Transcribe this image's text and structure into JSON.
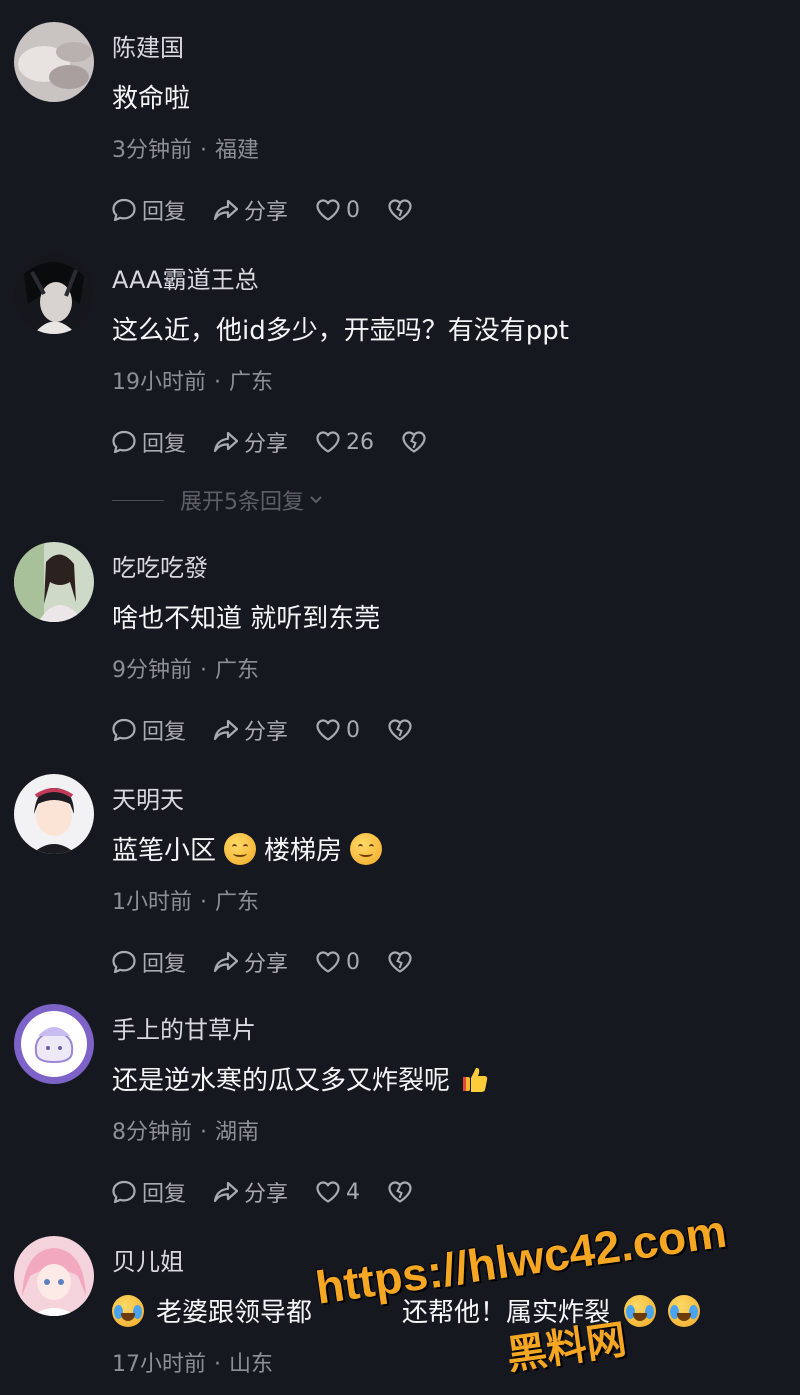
{
  "actions": {
    "reply_label": "回复",
    "share_label": "分享"
  },
  "expand_replies_label": "展开5条回复",
  "comments": [
    {
      "username": "陈建国",
      "text": "救命啦",
      "time": "3分钟前",
      "location": "福建",
      "likes": "0"
    },
    {
      "username": "AAA霸道王总",
      "text": "这么近，他id多少，开壶吗？有没有ppt",
      "time": "19小时前",
      "location": "广东",
      "likes": "26"
    },
    {
      "username": "吃吃吃發",
      "text": "啥也不知道 就听到东莞",
      "time": "9分钟前",
      "location": "广东",
      "likes": "0"
    },
    {
      "username": "天明天",
      "text_a": "蓝笔小区",
      "text_b": "楼梯房",
      "time": "1小时前",
      "location": "广东",
      "likes": "0"
    },
    {
      "username": "手上的甘草片",
      "text": "还是逆水寒的瓜又多又炸裂呢",
      "time": "8分钟前",
      "location": "湖南",
      "likes": "4"
    },
    {
      "username": "贝儿姐",
      "text_a": "老婆跟领导都",
      "text_b": "还帮他！属实炸裂",
      "time": "17小时前",
      "location": "山东"
    }
  ],
  "watermark": {
    "url": "https://hlwc42.com",
    "name": "黑料网"
  },
  "colors": {
    "background": "#16181f",
    "watermark": "#f5a623"
  },
  "icons": [
    "reply-bubble-icon",
    "share-arrow-icon",
    "heart-icon",
    "broken-heart-icon",
    "chevron-down-icon",
    "smile-emoji",
    "cry-laugh-emoji",
    "thumbs-up-emoji"
  ]
}
